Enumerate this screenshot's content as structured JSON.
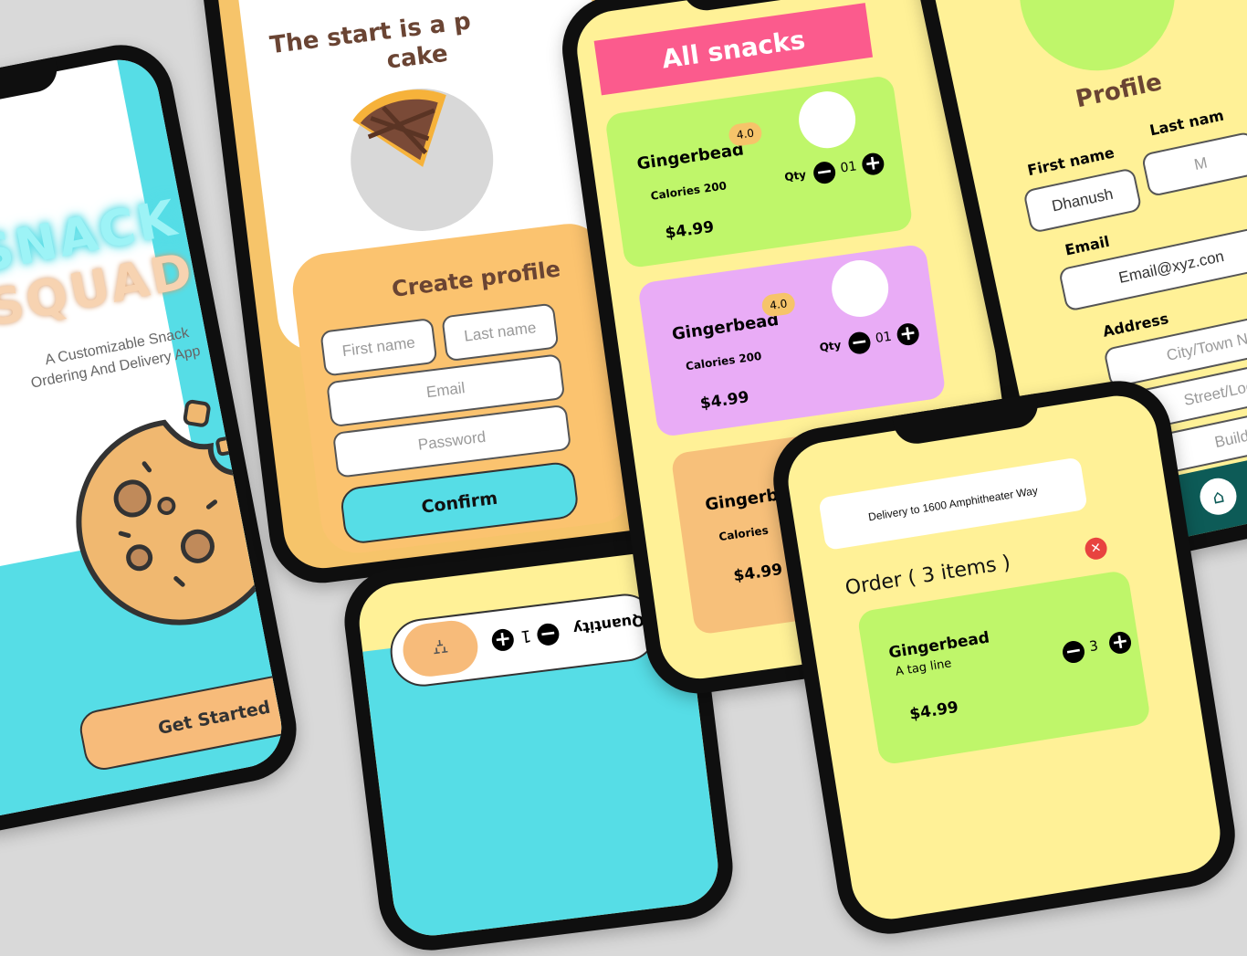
{
  "colors": {
    "cyan": "#56dde6",
    "orange": "#f6c46a",
    "yellow": "#fff197",
    "pink": "#fb5b8d",
    "green": "#bff66a",
    "purple": "#e9acf6",
    "peach": "#f7c07a",
    "brown": "#6a4433",
    "red": "#e8433f"
  },
  "splash": {
    "title_line1": "SNACK",
    "title_line2": "SQUAD",
    "tagline_line1": "A Customizable Snack",
    "tagline_line2": "Ordering And Delivery App",
    "cta": "Get Started"
  },
  "create_profile": {
    "header_line1": "The start is a p",
    "header_line2": "cake",
    "title": "Create profile",
    "first_name_placeholder": "First name",
    "last_name_placeholder": "Last name",
    "email_placeholder": "Email",
    "password_placeholder": "Password",
    "confirm": "Confirm"
  },
  "snacks": {
    "title": "All snacks",
    "items": [
      {
        "name": "Gingerbead",
        "rating": "4.0",
        "calories": "Calories 200",
        "qty_label": "Qty",
        "qty": "01",
        "price": "$4.99"
      },
      {
        "name": "Gingerbead",
        "rating": "4.0",
        "calories": "Calories 200",
        "qty_label": "Qty",
        "qty": "01",
        "price": "$4.99"
      },
      {
        "name": "Gingerbead",
        "calories": "Calories",
        "price": "$4.99"
      }
    ]
  },
  "profile": {
    "title": "Profile",
    "first_name_label": "First name",
    "first_name_value": "Dhanush",
    "last_name_label": "Last nam",
    "last_name_value": "M",
    "email_label": "Email",
    "email_value": "Email@xyz.con",
    "address_label": "Address",
    "city_placeholder": "City/Town Na",
    "street_placeholder": "Street/Local Ar",
    "building_placeholder": "Building floo",
    "icons": [
      "home-icon",
      "search-icon"
    ]
  },
  "quantity_screen": {
    "label": "Quantity",
    "qty": "1",
    "icon": "bed-icon"
  },
  "order": {
    "delivery": "Delivery to 1600 Amphitheater Way",
    "title": "Order ( 3 items )",
    "item_name": "Gingerbead",
    "item_tagline": "A tag line",
    "item_qty": "3",
    "item_price": "$4.99"
  }
}
